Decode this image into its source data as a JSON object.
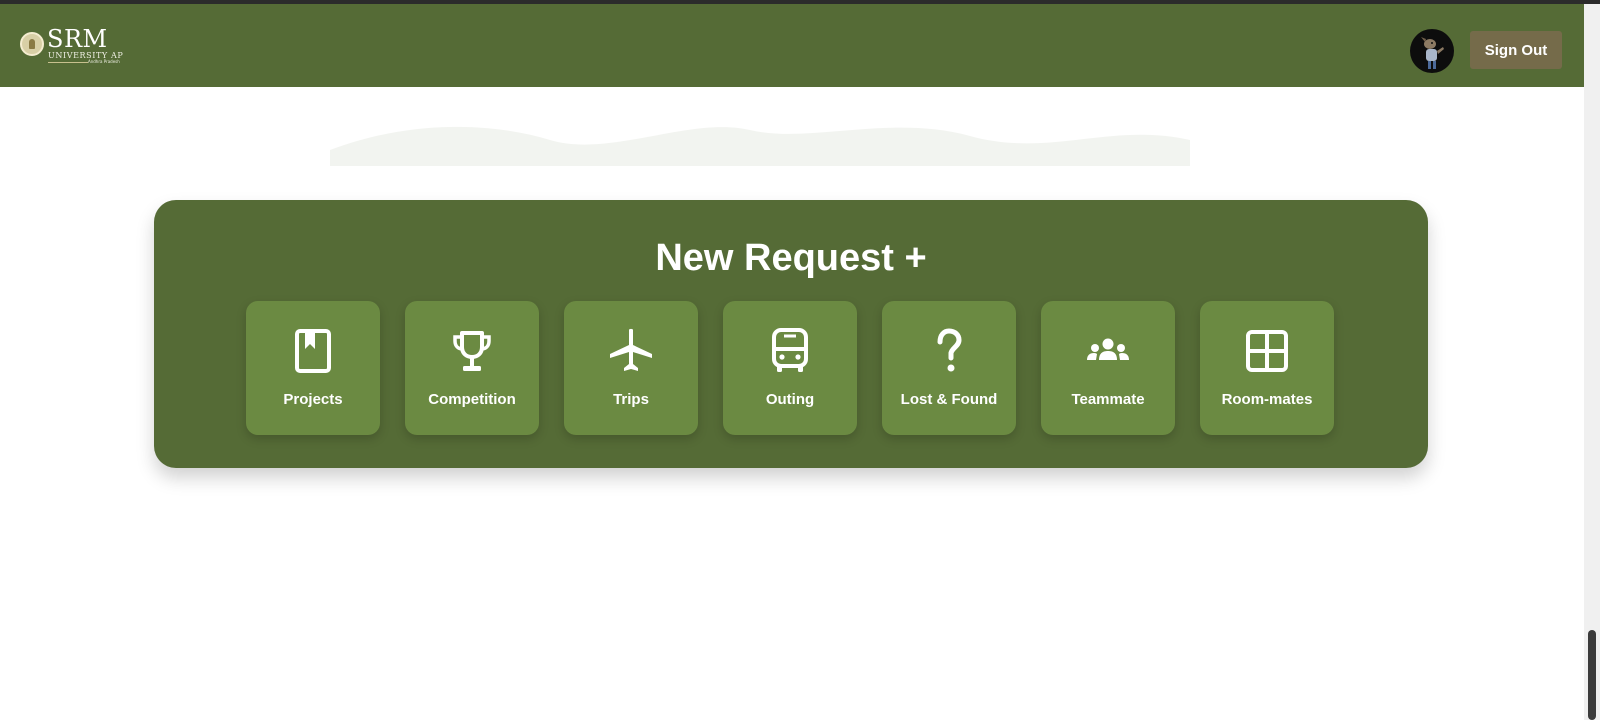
{
  "header": {
    "logo_text": "SRM",
    "logo_subtitle": "UNIVERSITY AP",
    "logo_tagline": "Andhra Pradesh",
    "avatar_icon": "user-avatar",
    "signout_label": "Sign Out",
    "brand_color": "#556b36"
  },
  "panel": {
    "title": "New Request +",
    "tiles": [
      {
        "label": "Projects",
        "icon": "bookmark-book-icon"
      },
      {
        "label": "Competition",
        "icon": "trophy-icon"
      },
      {
        "label": "Trips",
        "icon": "airplane-icon"
      },
      {
        "label": "Outing",
        "icon": "bus-icon"
      },
      {
        "label": "Lost & Found",
        "icon": "question-icon"
      },
      {
        "label": "Teammate",
        "icon": "group-icon"
      },
      {
        "label": "Room-mates",
        "icon": "grid-icon"
      }
    ]
  },
  "colors": {
    "panel": "#556b36",
    "tile": "#6b8a42",
    "signout": "#756b4a"
  }
}
